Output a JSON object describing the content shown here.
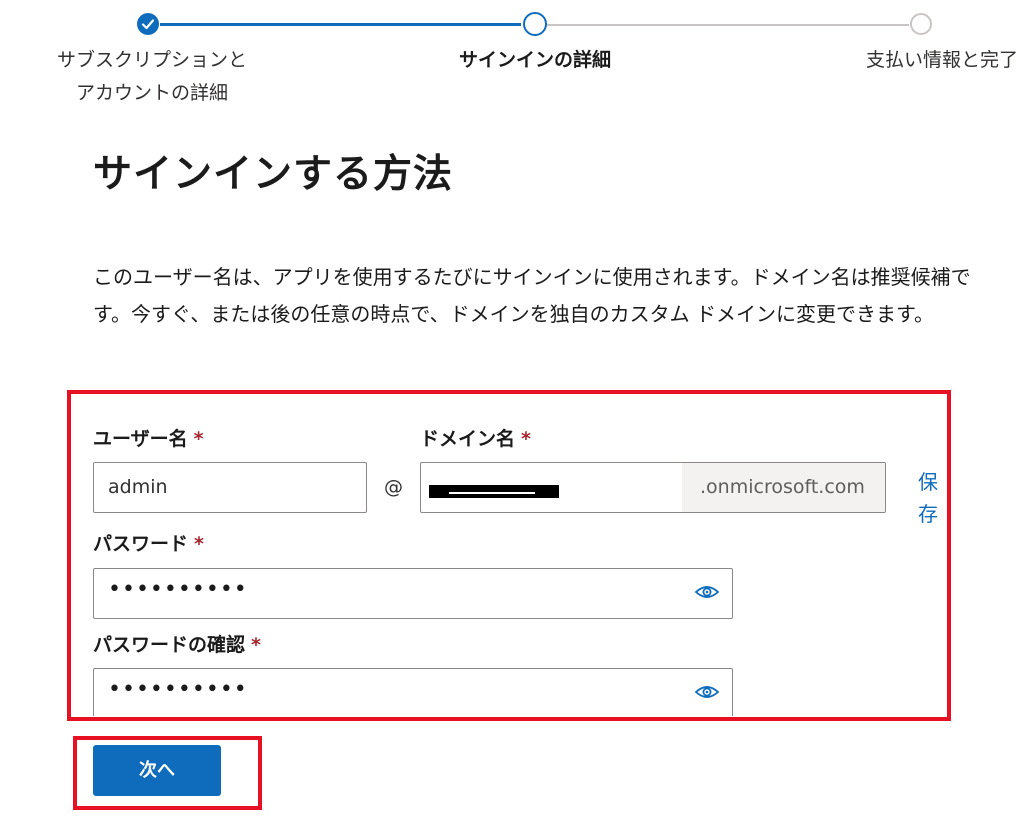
{
  "stepper": {
    "steps": [
      {
        "label_line1": "サブスクリプションと",
        "label_line2": "アカウントの詳細",
        "state": "complete"
      },
      {
        "label": "サインインの詳細",
        "state": "current"
      },
      {
        "label": "支払い情報と完了",
        "state": "upcoming"
      }
    ]
  },
  "page": {
    "title": "サインインする方法",
    "description": "このユーザー名は、アプリを使用するたびにサインインに使用されます。ドメイン名は推奨候補です。今すぐ、または後の任意の時点で、ドメインを独自のカスタム ドメインに変更できます。"
  },
  "form": {
    "username": {
      "label": "ユーザー名",
      "value": "admin",
      "required_mark": "*"
    },
    "at_symbol": "@",
    "domain": {
      "label": "ドメイン名",
      "required_mark": "*",
      "suffix": ".onmicrosoft.com"
    },
    "save_link": "保存",
    "password": {
      "label": "パスワード",
      "required_mark": "*",
      "masked_value": "••••••••••"
    },
    "confirm_password": {
      "label": "パスワードの確認",
      "required_mark": "*",
      "masked_value": "••••••••••"
    }
  },
  "actions": {
    "next_label": "次へ"
  },
  "colors": {
    "accent": "#0f6cbd",
    "highlight_border": "#e81123",
    "required": "#a4262c"
  }
}
